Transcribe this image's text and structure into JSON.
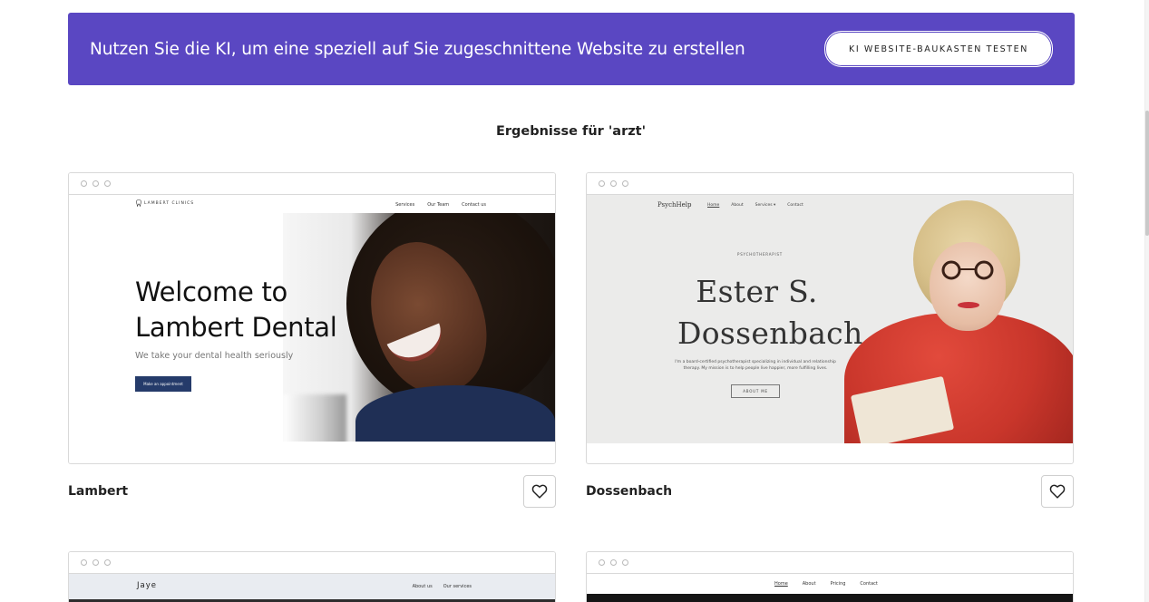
{
  "banner": {
    "text": "Nutzen Sie die KI, um eine speziell auf Sie zugeschnittene Website zu erstellen",
    "button_label": "KI WEBSITE-BAUKASTEN TESTEN",
    "background_color": "#5a47c2"
  },
  "results": {
    "heading": "Ergebnisse für 'arzt'"
  },
  "templates": [
    {
      "name": "Lambert",
      "preview": {
        "logo": "LAMBERT CLINICS",
        "nav": [
          "Services",
          "Our Team",
          "Contact us"
        ],
        "title_line1": "Welcome to",
        "title_line2": "Lambert Dental",
        "subtitle": "We take your dental health seriously",
        "cta": "Make an appointment"
      }
    },
    {
      "name": "Dossenbach",
      "preview": {
        "logo": "PsychHelp",
        "nav": [
          "Home",
          "About",
          "Services ▾",
          "Contact"
        ],
        "kicker": "PSYCHOTHERAPIST",
        "title_line1": "Ester S.",
        "title_line2": "Dossenbach",
        "description": "I'm a board-certified psychotherapist specializing in individual and relationship therapy. My mission is to help people live happier, more fulfilling lives.",
        "cta": "ABOUT ME"
      }
    },
    {
      "name": "",
      "preview": {
        "logo": "Jaye",
        "nav": [
          "About us",
          "Our services"
        ]
      }
    },
    {
      "name": "",
      "preview": {
        "nav": [
          "Home",
          "About",
          "Pricing",
          "Contact"
        ]
      }
    }
  ],
  "icons": {
    "favorite": "heart-outline-icon",
    "window_dots": "browser-dots-icon",
    "tooth": "tooth-icon"
  }
}
